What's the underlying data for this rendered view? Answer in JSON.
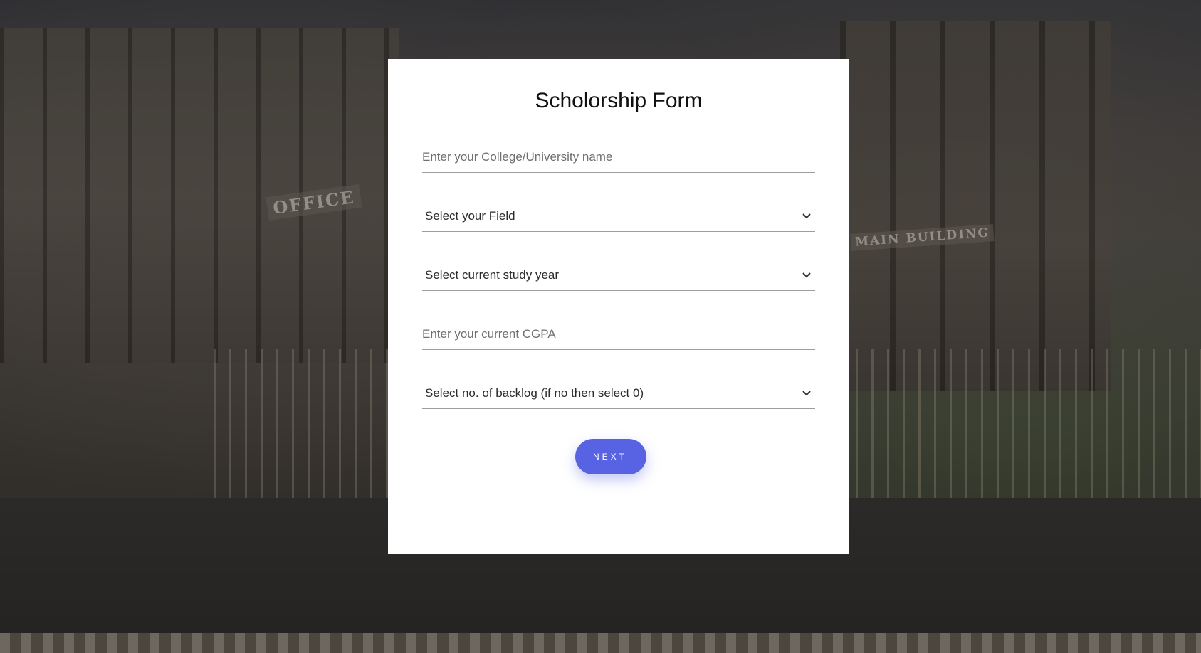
{
  "background": {
    "signs": {
      "office": "OFFICE",
      "main_building": "MAIN BUILDING"
    }
  },
  "form": {
    "title": "Scholorship Form",
    "college_field": {
      "placeholder": "Enter your College/University name",
      "value": ""
    },
    "field_select": {
      "selected": "Select your Field",
      "icon": "chevron-down-icon"
    },
    "study_year_select": {
      "selected": "Select current study year",
      "icon": "chevron-down-icon"
    },
    "cgpa_field": {
      "placeholder": "Enter your current CGPA",
      "value": ""
    },
    "backlog_select": {
      "selected": "Select no. of backlog (if no then select 0)",
      "icon": "chevron-down-icon"
    },
    "next_label": "NEXT"
  },
  "colors": {
    "accent": "#5763e2",
    "card_background": "#ffffff",
    "underline": "#9e9e9e"
  }
}
